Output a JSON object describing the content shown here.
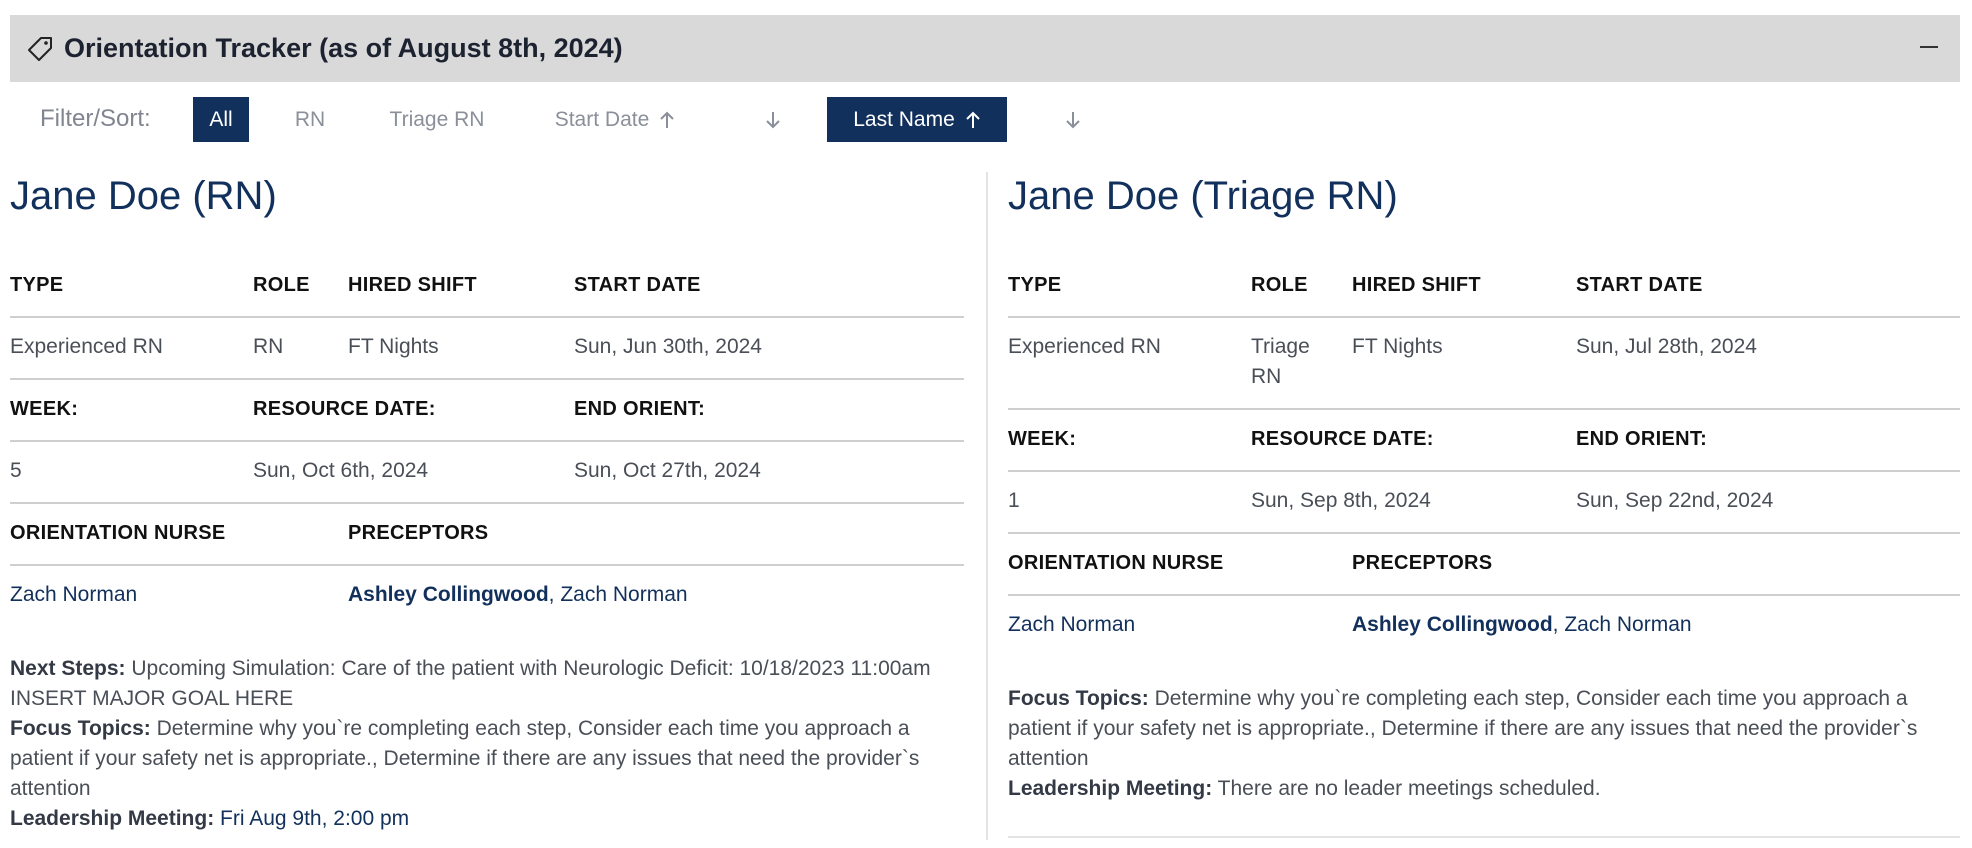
{
  "header": {
    "title": "Orientation Tracker (as of August 8th, 2024)"
  },
  "filter": {
    "label": "Filter/Sort:",
    "chips": [
      "All",
      "RN",
      "Triage RN",
      "Start Date",
      "Last Name"
    ]
  },
  "labels": {
    "type": "TYPE",
    "role": "ROLE",
    "hired_shift": "HIRED SHIFT",
    "start_date": "START DATE",
    "week": "WEEK:",
    "resource_date": "RESOURCE DATE:",
    "end_orient": "END ORIENT:",
    "orientation_nurse": "ORIENTATION NURSE",
    "preceptors": "PRECEPTORS",
    "next_steps": "Next Steps:",
    "focus_topics": "Focus Topics:",
    "leadership_meeting": "Leadership Meeting:"
  },
  "cards": [
    {
      "title": "Jane Doe (RN)",
      "type": "Experienced RN",
      "role": "RN",
      "hired_shift": "FT Nights",
      "start_date": "Sun, Jun 30th, 2024",
      "week": "5",
      "resource_date": "Sun, Oct 6th, 2024",
      "end_orient": "Sun, Oct 27th, 2024",
      "orientation_nurse": "Zach Norman",
      "preceptor_primary": "Ashley Collingwood",
      "preceptor_rest": ", Zach Norman",
      "next_steps": "Upcoming Simulation: Care of the patient with Neurologic Deficit: 10/18/2023 11:00am INSERT MAJOR GOAL HERE",
      "focus_topics": "Determine why you`re completing each step, Consider each time you approach a patient if your safety net is appropriate., Determine if there are any issues that need the provider`s attention",
      "leadership_meeting": "Fri Aug 9th, 2:00 pm"
    },
    {
      "title": "Jane Doe (Triage RN)",
      "type": "Experienced RN",
      "role_line1": "Triage",
      "role_line2": "RN",
      "hired_shift": "FT Nights",
      "start_date": "Sun, Jul 28th, 2024",
      "week": "1",
      "resource_date": "Sun, Sep 8th, 2024",
      "end_orient": "Sun, Sep 22nd, 2024",
      "orientation_nurse": "Zach Norman",
      "preceptor_primary": "Ashley Collingwood",
      "preceptor_rest": ", Zach Norman",
      "focus_topics": "Determine why you`re completing each step, Consider each time you approach a patient if your safety net is appropriate., Determine if there are any issues that need the provider`s attention",
      "leadership_meeting": "There are no leader meetings scheduled."
    }
  ]
}
